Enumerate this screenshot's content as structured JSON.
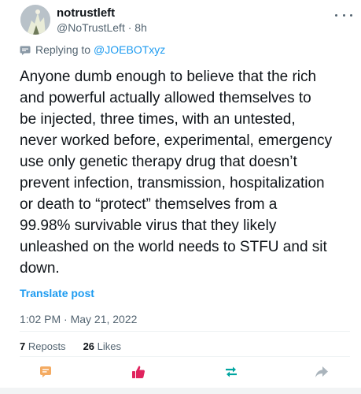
{
  "post": {
    "author_name": "notrustleft",
    "author_handle": "@NoTrustLeft",
    "separator": " · ",
    "time_ago": "8h",
    "replying_label": "Replying to",
    "replying_to": "@JOEBOTxyz",
    "text": "Anyone dumb enough to believe that the rich\nand powerful actually allowed themselves to\nbe injected, three times, with an untested,\nnever worked before, experimental, emergency\nuse only genetic therapy drug that doesn’t\nprevent infection, transmission, hospitalization\nor death to “protect” themselves from a\n99.98% survivable virus that they likely\nunleashed on the world needs to STFU and sit\ndown.",
    "translate_label": "Translate post",
    "timestamp": "1:02 PM · May 21, 2022"
  },
  "stats": {
    "reposts_count": "7",
    "reposts_label": "Reposts",
    "likes_count": "26",
    "likes_label": "Likes"
  },
  "colors": {
    "accent": "#1d9bf0",
    "like_active": "#e0245e",
    "repost": "#00a5a0",
    "comment": "#f4ab62",
    "muted": "#536471"
  },
  "icons": [
    "more-icon",
    "reply-icon",
    "comment-icon",
    "thumbs-up-icon",
    "repost-icon",
    "share-icon"
  ]
}
